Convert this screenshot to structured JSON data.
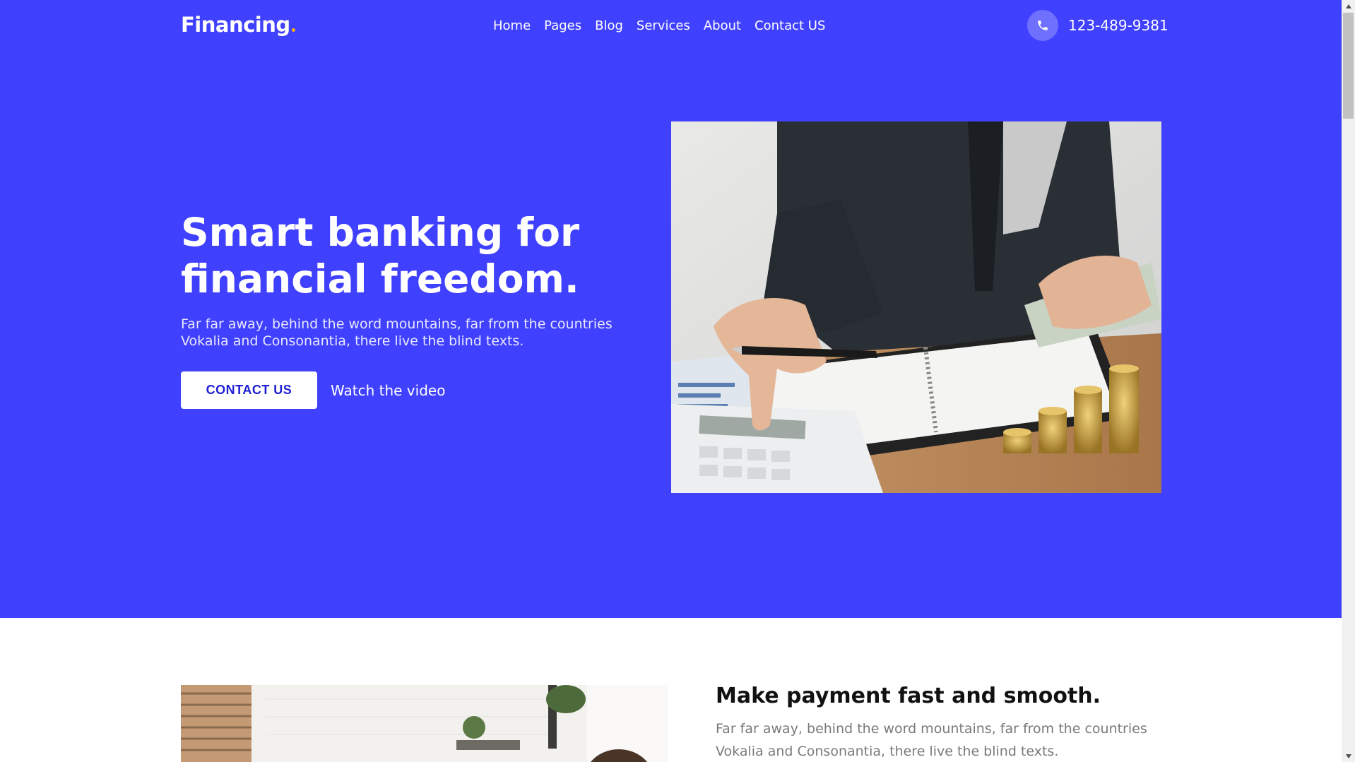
{
  "header": {
    "logo": "Financing",
    "nav": [
      "Home",
      "Pages",
      "Blog",
      "Services",
      "About",
      "Contact US"
    ],
    "phone": "123-489-9381"
  },
  "hero": {
    "title": "Smart banking for financial freedom.",
    "text": "Far far away, behind the word mountains, far from the countries Vokalia and Consonantia, there live the blind texts.",
    "cta_label": "CONTACT US",
    "video_link": "Watch the video"
  },
  "section2": {
    "title": "Make payment fast and smooth.",
    "text": "Far far away, behind the word mountains, far from the countries Vokalia and Consonantia, there live the blind texts."
  },
  "colors": {
    "brand": "#4040ff",
    "button_text": "#1f1fd6",
    "logo_dot": "#ffb400"
  },
  "icons": {
    "phone": "phone-icon",
    "scroll_up": "chevron-up-icon",
    "scroll_down": "chevron-down-icon"
  }
}
